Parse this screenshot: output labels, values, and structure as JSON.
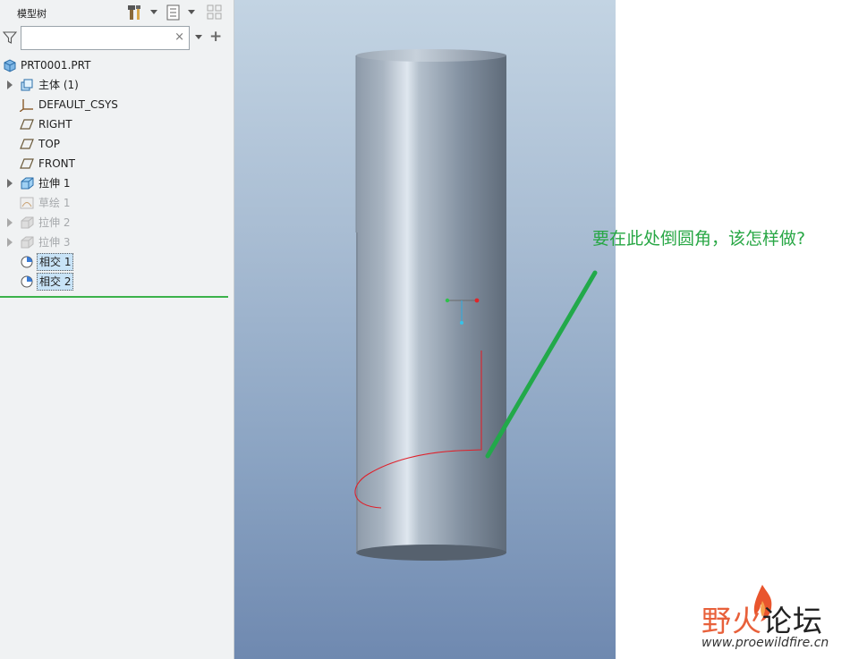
{
  "panel": {
    "title": "模型树",
    "search": {
      "value": "",
      "clear_glyph": "×"
    },
    "add_glyph": "+"
  },
  "tree": {
    "root": "PRT0001.PRT",
    "items": [
      {
        "label": "主体 (1)",
        "icon": "body-icon",
        "expandable": true,
        "dim": false,
        "selected": false
      },
      {
        "label": "DEFAULT_CSYS",
        "icon": "csys-icon",
        "expandable": false,
        "dim": false,
        "selected": false
      },
      {
        "label": "RIGHT",
        "icon": "datum-plane-icon",
        "expandable": false,
        "dim": false,
        "selected": false
      },
      {
        "label": "TOP",
        "icon": "datum-plane-icon",
        "expandable": false,
        "dim": false,
        "selected": false
      },
      {
        "label": "FRONT",
        "icon": "datum-plane-icon",
        "expandable": false,
        "dim": false,
        "selected": false
      },
      {
        "label": "拉伸 1",
        "icon": "extrude-icon",
        "expandable": true,
        "dim": false,
        "selected": false
      },
      {
        "label": "草绘 1",
        "icon": "sketch-icon",
        "expandable": false,
        "dim": true,
        "selected": false
      },
      {
        "label": "拉伸 2",
        "icon": "extrude-icon",
        "expandable": true,
        "dim": true,
        "selected": false
      },
      {
        "label": "拉伸 3",
        "icon": "extrude-icon",
        "expandable": true,
        "dim": true,
        "selected": false
      },
      {
        "label": "相交 1",
        "icon": "intersect-icon",
        "expandable": false,
        "dim": false,
        "selected": true
      },
      {
        "label": "相交 2",
        "icon": "intersect-icon",
        "expandable": false,
        "dim": false,
        "selected": true
      }
    ]
  },
  "annotation": {
    "text": "要在此处倒圆角，该怎样做?",
    "color": "#28a745"
  },
  "logo": {
    "cn_a": "野火",
    "cn_b": "论坛",
    "url": "www.proewildfire.cn"
  },
  "colors": {
    "viewport_top": "#c3d4e3",
    "viewport_bottom": "#6f89b0",
    "curve": "#e0202a",
    "arrow": "#22a94a"
  }
}
